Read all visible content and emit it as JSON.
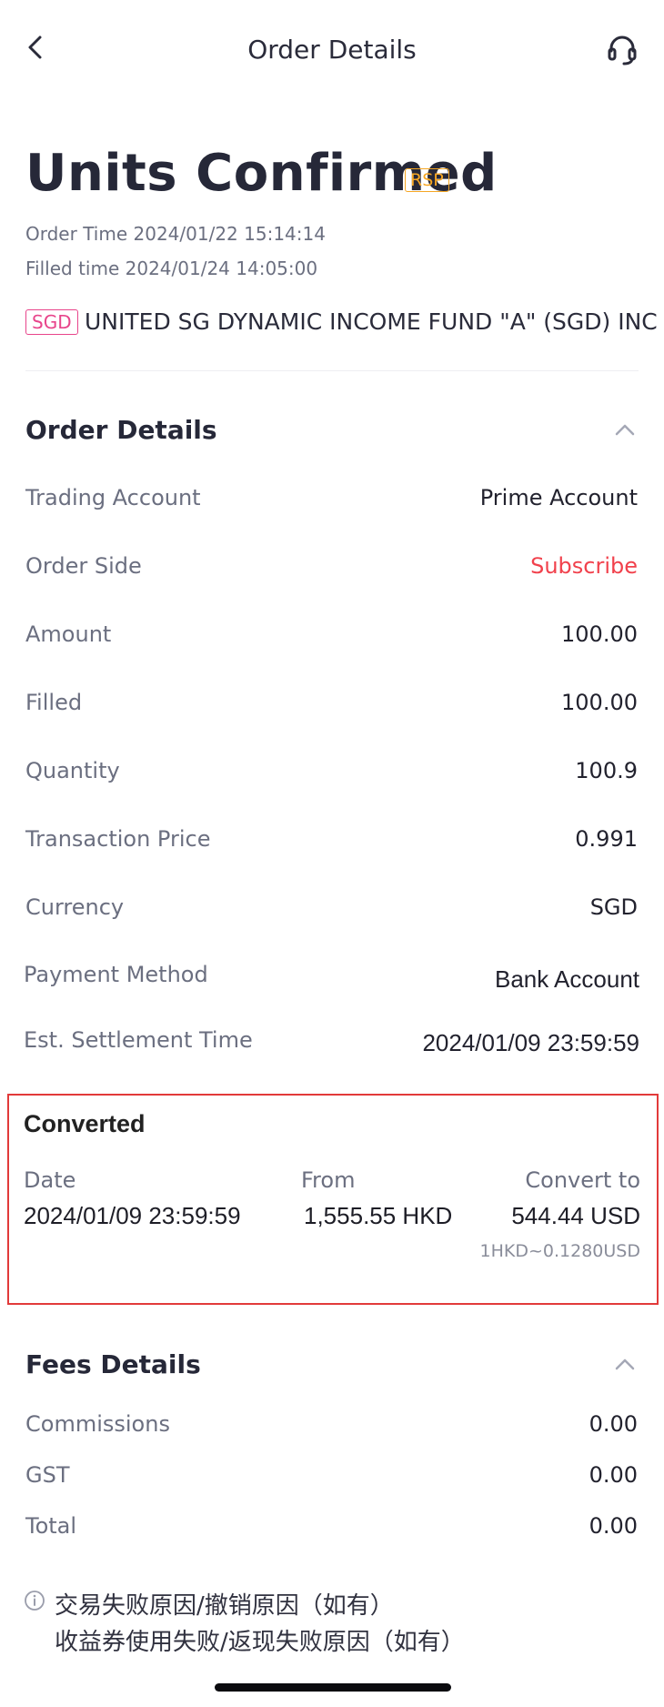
{
  "header": {
    "title": "Order Details",
    "back_icon": "chevron-left-icon",
    "support_icon": "headset-icon"
  },
  "status": {
    "title": "Units Confirmed",
    "badge": "RSP",
    "order_time": "Order Time 2024/01/22 15:14:14",
    "filled_time": "Filled time 2024/01/24 14:05:00"
  },
  "fund": {
    "currency_badge": "SGD",
    "name": "UNITED SG DYNAMIC INCOME FUND \"A\" (SGD) INC"
  },
  "order_details": {
    "title": "Order Details",
    "rows": [
      {
        "label": "Trading Account",
        "value": "Prime Account"
      },
      {
        "label": "Order Side",
        "value": "Subscribe"
      },
      {
        "label": "Amount",
        "value": "100.00"
      },
      {
        "label": "Filled",
        "value": "100.00"
      },
      {
        "label": "Quantity",
        "value": "100.9"
      },
      {
        "label": "Transaction Price",
        "value": "0.991"
      },
      {
        "label": "Currency",
        "value": "SGD"
      },
      {
        "label": "Payment Method",
        "value": "Bank Account"
      },
      {
        "label": "Est. Settlement Time",
        "value": "2024/01/09 23:59:59"
      }
    ]
  },
  "converted": {
    "title": "Converted",
    "date_label": "Date",
    "from_label": "From",
    "to_label": "Convert to",
    "date_value": "2024/01/09 23:59:59",
    "from_value": "1,555.55 HKD",
    "to_value": "544.44 USD",
    "rate": "1HKD~0.1280USD"
  },
  "fees": {
    "title": "Fees Details",
    "rows": [
      {
        "label": "Commissions",
        "value": "0.00"
      },
      {
        "label": "GST",
        "value": "0.00"
      },
      {
        "label": "Total",
        "value": "0.00"
      }
    ]
  },
  "notes": {
    "line1": "交易失败原因/撤销原因（如有）",
    "line2": "收益券使用失败/返现失败原因（如有）"
  },
  "colors": {
    "accent_red": "#f1414c",
    "rsp": "#f5a623",
    "currency_badge": "#e8458b",
    "highlight_border": "#e23a3a"
  }
}
